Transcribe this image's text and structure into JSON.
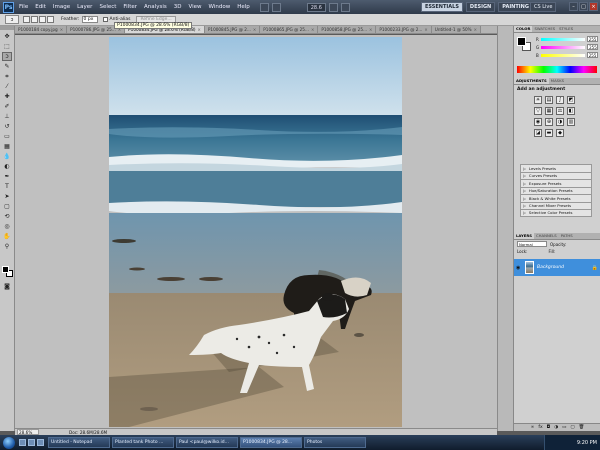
{
  "menubar": {
    "logo": "Ps",
    "items": [
      "File",
      "Edit",
      "Image",
      "Layer",
      "Select",
      "Filter",
      "Analysis",
      "3D",
      "View",
      "Window",
      "Help"
    ],
    "zoom": "28.6"
  },
  "workspace": {
    "buttons": [
      "ESSENTIALS",
      "DESIGN",
      "PAINTING"
    ],
    "cslive": "CS Live"
  },
  "options": {
    "feather_label": "Feather:",
    "feather_value": "0 px",
    "anti_alias_label": "Anti-alias",
    "refine_label": "Refine Edge...",
    "tooltip": "P1000834.JPG @ 28.6% (RGB/8)"
  },
  "tabs": [
    {
      "label": "P1000184 copy.jpg",
      "active": false
    },
    {
      "label": "P1000786.JPG @ 25...",
      "active": false
    },
    {
      "label": "P1000834.JPG @ 28.6% (RGB/8)",
      "active": true
    },
    {
      "label": "P1000845.JPG @ 2...",
      "active": false
    },
    {
      "label": "P1000865.JPG @ 25...",
      "active": false
    },
    {
      "label": "P1000858.JPG @ 25...",
      "active": false
    },
    {
      "label": "P1000233.JPG @ 2...",
      "active": false
    },
    {
      "label": "Untitled-1 @ 50%",
      "active": false
    }
  ],
  "status": {
    "zoom": "28.6%",
    "doc": "Doc: 28.6M/28.6M"
  },
  "color_panel": {
    "tabs": [
      "COLOR",
      "SWATCHES",
      "STYLES"
    ],
    "r": "255",
    "g": "255",
    "b": "255"
  },
  "adjustments": {
    "tabs": [
      "ADJUSTMENTS",
      "MASKS"
    ],
    "title": "Add an adjustment",
    "presets": [
      "Levels Presets",
      "Curves Presets",
      "Exposure Presets",
      "Hue/Saturation Presets",
      "Black & White Presets",
      "Channel Mixer Presets",
      "Selective Color Presets"
    ]
  },
  "layers": {
    "tabs": [
      "LAYERS",
      "CHANNELS",
      "PATHS"
    ],
    "blend_mode": "Normal",
    "opacity_label": "Opacity:",
    "lock_label": "Lock:",
    "fill_label": "Fill:",
    "layer_name": "Background"
  },
  "taskbar": {
    "tasks": [
      {
        "label": "Untitled - Notepad",
        "active": false
      },
      {
        "label": "Planted tank Photo ...",
        "active": false
      },
      {
        "label": "Paul <paul@wilko.id...",
        "active": false
      },
      {
        "label": "P1000834.JPG @ 28...",
        "active": true
      },
      {
        "label": "Photos",
        "active": false
      }
    ],
    "time": "9:20 PM"
  }
}
